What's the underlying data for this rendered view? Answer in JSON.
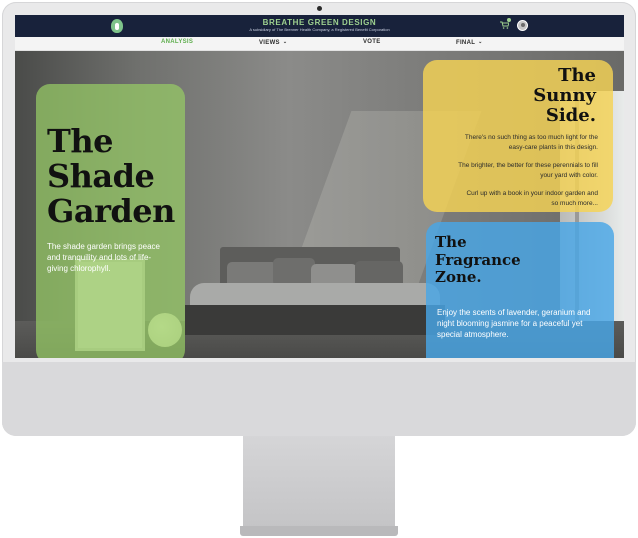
{
  "header": {
    "brand_title": "BREATHE GREEN DESIGN",
    "brand_subtitle": "A subsidiary of The Brenner Health Company, a Registered Benefit Corporation",
    "logo_icon": "leaf-logo-icon",
    "cart_icon": "cart-icon",
    "avatar_icon": "user-avatar-icon"
  },
  "nav": {
    "items": [
      {
        "label": "ANALYSIS",
        "active": true,
        "has_dropdown": false
      },
      {
        "label": "VIEWS",
        "active": false,
        "has_dropdown": true
      },
      {
        "label": "VOTE",
        "active": false,
        "has_dropdown": false
      },
      {
        "label": "FINAL",
        "active": false,
        "has_dropdown": true
      }
    ],
    "chevron_glyph": "⌄"
  },
  "panels": {
    "shade": {
      "title_lines": [
        "The",
        "Shade",
        "Garden"
      ],
      "body": "The shade garden brings peace and tranquility and lots of life-giving chlorophyll.",
      "color": "#97cc65"
    },
    "sunny": {
      "title_lines": [
        "The",
        "Sunny",
        "Side."
      ],
      "paragraphs": [
        "There's no such thing as too much light for the easy-care plants in this design.",
        "The brighter, the better for these perennials to fill your yard with color.",
        "Curl up with a book in your indoor garden and so much more..."
      ],
      "color": "#f5d354"
    },
    "fragrance": {
      "title_lines": [
        "The",
        "Fragrance",
        "Zone."
      ],
      "body": "Enjoy the scents of lavender, geranium and night blooming jasmine for a peaceful yet special atmosphere.",
      "color": "#48a6e6"
    }
  },
  "colors": {
    "topbar": "#18223b",
    "accent_green": "#5fae4e"
  }
}
